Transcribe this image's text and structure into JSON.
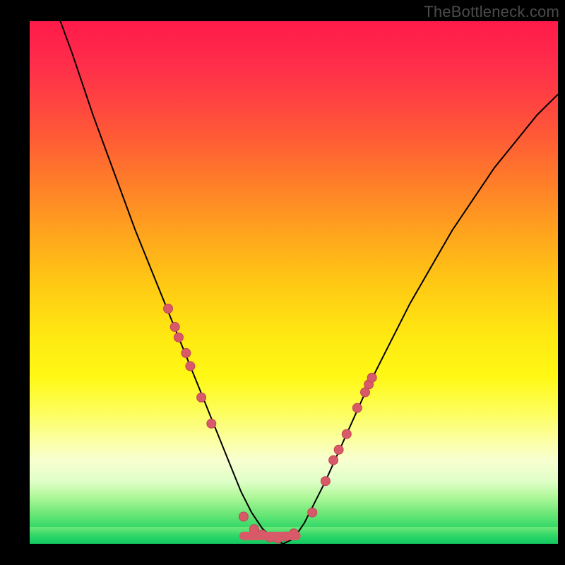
{
  "watermark": "TheBottleneck.com",
  "colors": {
    "dot_fill": "#d85a68",
    "dot_stroke": "#c04555",
    "curve_stroke": "#000000",
    "frame_bg": "#000000"
  },
  "chart_data": {
    "type": "line",
    "title": "",
    "xlabel": "",
    "ylabel": "",
    "xlim": [
      0,
      100
    ],
    "ylim": [
      0,
      100
    ],
    "series": [
      {
        "name": "bottleneck-curve",
        "x": [
          0,
          4,
          8,
          12,
          16,
          20,
          24,
          28,
          32,
          34,
          36,
          38,
          40,
          42,
          44,
          46,
          48,
          50,
          52,
          56,
          60,
          64,
          68,
          72,
          76,
          80,
          84,
          88,
          92,
          96,
          100
        ],
        "y": [
          115,
          105,
          94,
          82,
          71,
          60,
          50,
          40,
          30,
          25,
          20,
          15,
          10,
          6,
          3,
          1,
          0,
          1,
          4,
          12,
          21,
          30,
          38,
          46,
          53,
          60,
          66,
          72,
          77,
          82,
          86
        ]
      }
    ],
    "markers_left": [
      {
        "x": 26.2,
        "y": 45.0
      },
      {
        "x": 27.5,
        "y": 41.5
      },
      {
        "x": 28.2,
        "y": 39.5
      },
      {
        "x": 29.6,
        "y": 36.5
      },
      {
        "x": 30.4,
        "y": 34.0
      },
      {
        "x": 32.5,
        "y": 28.0
      },
      {
        "x": 34.4,
        "y": 23.0
      }
    ],
    "markers_right": [
      {
        "x": 53.5,
        "y": 6.0
      },
      {
        "x": 56.0,
        "y": 12.0
      },
      {
        "x": 57.5,
        "y": 16.0
      },
      {
        "x": 58.5,
        "y": 18.0
      },
      {
        "x": 60.0,
        "y": 21.0
      },
      {
        "x": 62.0,
        "y": 26.0
      },
      {
        "x": 63.5,
        "y": 29.0
      },
      {
        "x": 64.2,
        "y": 30.5
      },
      {
        "x": 64.8,
        "y": 31.8
      }
    ],
    "markers_bottom": [
      {
        "x": 40.5,
        "y": 5.2
      },
      {
        "x": 42.5,
        "y": 2.8
      },
      {
        "x": 44.0,
        "y": 1.8
      },
      {
        "x": 45.5,
        "y": 1.2
      },
      {
        "x": 47.0,
        "y": 1.0
      },
      {
        "x": 48.5,
        "y": 1.4
      },
      {
        "x": 50.0,
        "y": 2.0
      }
    ],
    "bottom_run_segment": {
      "x0": 40.5,
      "x1": 50.5,
      "y": 1.5
    }
  }
}
